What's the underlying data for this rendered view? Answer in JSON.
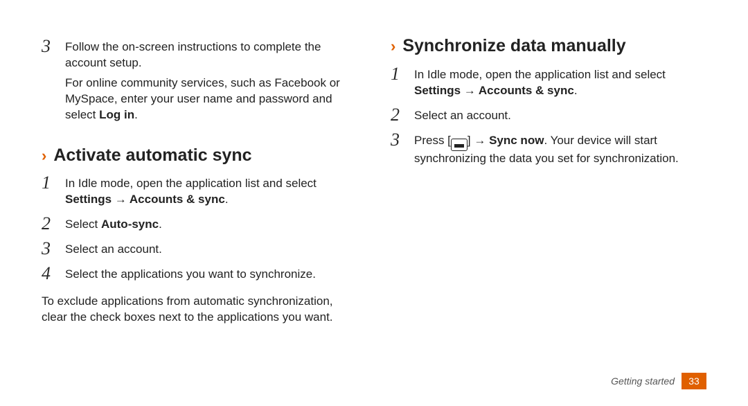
{
  "left": {
    "step3": {
      "num": "3",
      "p1a": "Follow the on-screen instructions to complete the account setup.",
      "p2a": "For online community services, such as Facebook or MySpace, enter your user name and password and select ",
      "p2b": "Log in",
      "p2c": "."
    },
    "heading": "Activate automatic sync",
    "s1": {
      "num": "1",
      "a": "In Idle mode, open the application list and select ",
      "b": "Settings → Accounts & sync",
      "c": "."
    },
    "s2": {
      "num": "2",
      "a": "Select ",
      "b": "Auto-sync",
      "c": "."
    },
    "s3": {
      "num": "3",
      "a": "Select an account."
    },
    "s4": {
      "num": "4",
      "a": "Select the applications you want to synchronize."
    },
    "note": "To exclude applications from automatic synchronization, clear the check boxes next to the applications you want."
  },
  "right": {
    "heading": "Synchronize data manually",
    "s1": {
      "num": "1",
      "a": "In Idle mode, open the application list and select ",
      "b": "Settings → Accounts & sync",
      "c": "."
    },
    "s2": {
      "num": "2",
      "a": "Select an account."
    },
    "s3": {
      "num": "3",
      "a": "Press [",
      "b": "] → ",
      "c": "Sync now",
      "d": ". Your device will start synchronizing the data you set for synchronization."
    }
  },
  "footer": {
    "section": "Getting started",
    "page": "33"
  }
}
